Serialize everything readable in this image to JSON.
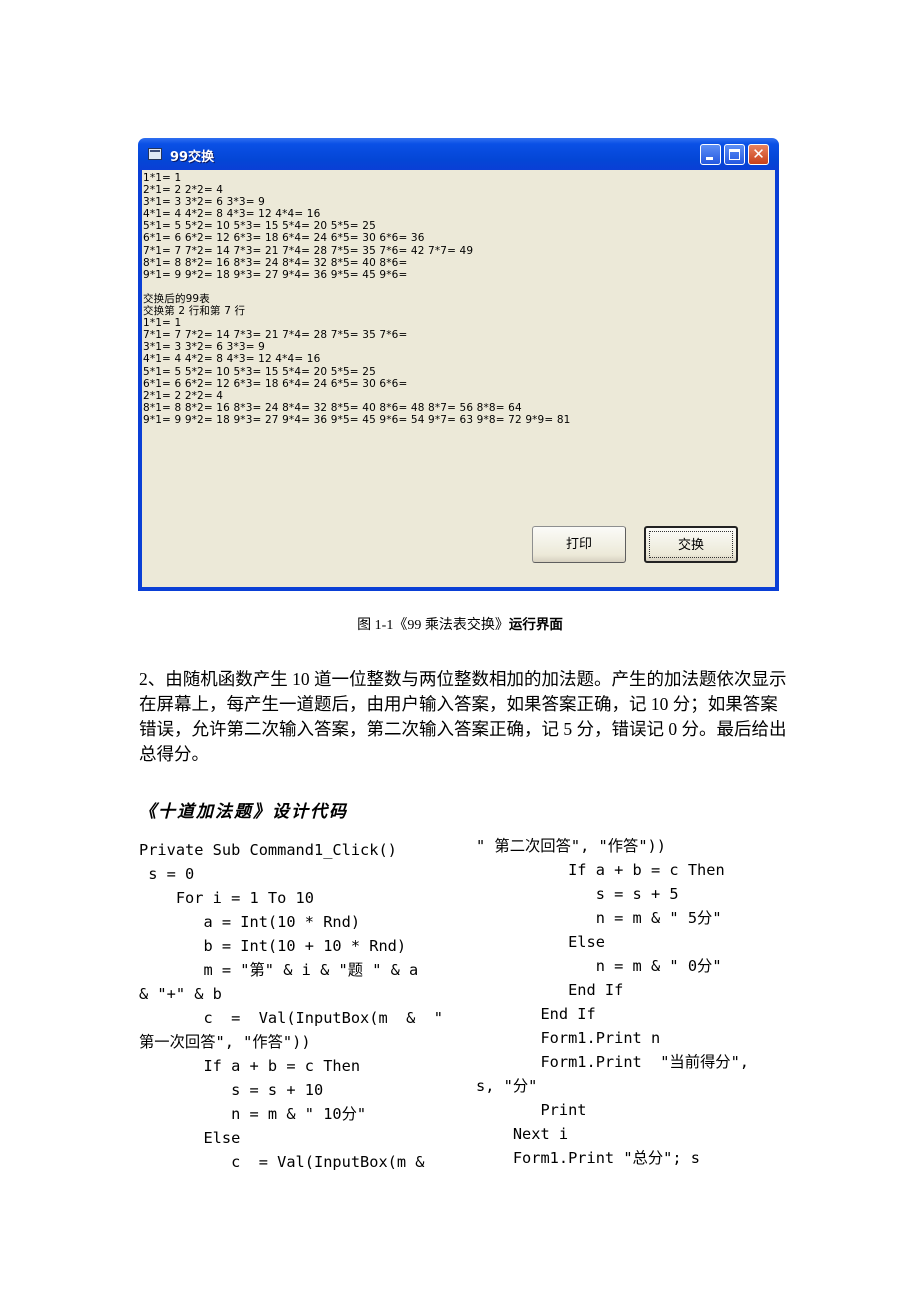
{
  "window": {
    "title": "99交换",
    "controls": {
      "minimize": "minimize",
      "maximize": "maximize",
      "close": "✕"
    },
    "output_lines": [
      "1*1= 1",
      "2*1= 2 2*2= 4",
      "3*1= 3 3*2= 6 3*3= 9",
      "4*1= 4 4*2= 8 4*3= 12 4*4= 16",
      "5*1= 5 5*2= 10 5*3= 15 5*4= 20 5*5= 25",
      "6*1= 6 6*2= 12 6*3= 18 6*4= 24 6*5= 30 6*6= 36",
      "7*1= 7 7*2= 14 7*3= 21 7*4= 28 7*5= 35 7*6= 42 7*7= 49",
      "8*1= 8 8*2= 16 8*3= 24 8*4= 32 8*5= 40 8*6=",
      "9*1= 9 9*2= 18 9*3= 27 9*4= 36 9*5= 45 9*6=",
      "",
      "交换后的99表",
      "交换第 2 行和第 7 行",
      "1*1= 1",
      "7*1= 7 7*2= 14 7*3= 21 7*4= 28 7*5= 35 7*6=",
      "3*1= 3 3*2= 6 3*3= 9",
      "4*1= 4 4*2= 8 4*3= 12 4*4= 16",
      "5*1= 5 5*2= 10 5*3= 15 5*4= 20 5*5= 25",
      "6*1= 6 6*2= 12 6*3= 18 6*4= 24 6*5= 30 6*6=",
      "2*1= 2 2*2= 4",
      "8*1= 8 8*2= 16 8*3= 24 8*4= 32 8*5= 40 8*6= 48 8*7= 56 8*8= 64",
      "9*1= 9 9*2= 18 9*3= 27 9*4= 36 9*5= 45 9*6= 54 9*7= 63 9*8= 72 9*9= 81"
    ],
    "buttons": {
      "print": "打印",
      "swap": "交换"
    }
  },
  "caption": {
    "prefix": "图 1-1《99 乘法表交换》",
    "suffix": "运行界面"
  },
  "paragraph": "2、由随机函数产生 10 道一位整数与两位整数相加的加法题。产生的加法题依次显示在屏幕上，每产生一道题后，由用户输入答案，如果答案正确，记 10 分；如果答案错误，允许第二次输入答案，第二次输入答案正确，记 5 分，错误记 0 分。最后给出总得分。",
  "code_heading": "《十道加法题》设计代码",
  "code_left": [
    "Private Sub Command1_Click()",
    " s = 0",
    "    For i = 1 To 10",
    "       a = Int(10 * Rnd)",
    "       b = Int(10 + 10 * Rnd)",
    "       m = \"第\" & i & \"题 \" & a",
    "& \"+\" & b",
    "       c  =  Val(InputBox(m  &  \"",
    "第一次回答\", \"作答\"))",
    "       If a + b = c Then",
    "          s = s + 10",
    "          n = m & \" 10分\"",
    "       Else",
    "          c  = Val(InputBox(m &"
  ],
  "code_right": [
    "\" 第二次回答\", \"作答\"))",
    "          If a + b = c Then",
    "             s = s + 5",
    "             n = m & \" 5分\"",
    "          Else",
    "             n = m & \" 0分\"",
    "          End If",
    "       End If",
    "       Form1.Print n",
    "       Form1.Print  \"当前得分\",",
    "s, \"分\"",
    "       Print",
    "    Next i",
    "    Form1.Print \"总分\"; s"
  ]
}
